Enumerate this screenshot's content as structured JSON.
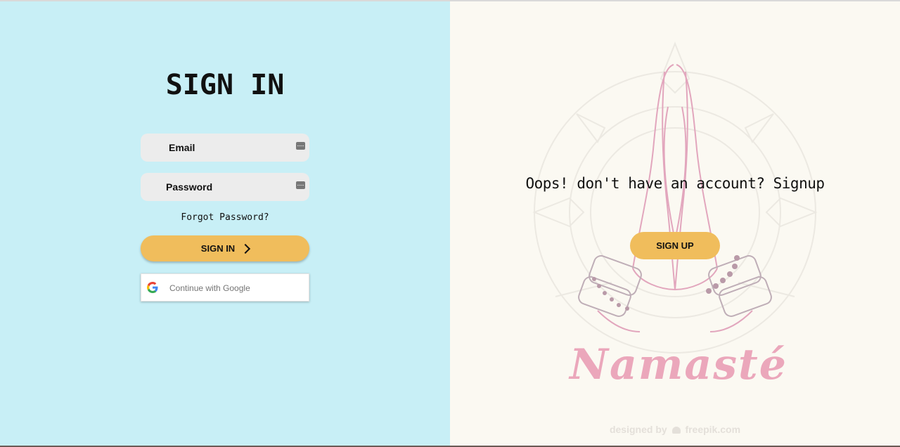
{
  "signin": {
    "title": "SIGN IN",
    "email_placeholder": "Email",
    "password_placeholder": "Password",
    "forgot_password": "Forgot Password?",
    "button_label": "SIGN IN",
    "google_label": "Continue with Google"
  },
  "signup_panel": {
    "prompt": "Oops! don't have an account? Signup",
    "button_label": "SIGN UP",
    "artwork_word": "Namasté",
    "credit_prefix": "designed by",
    "credit_brand": "freepik.com"
  },
  "colors": {
    "left_bg": "#c8eff6",
    "right_bg": "#fbf9f2",
    "accent": "#f0bd5c",
    "field_bg": "#ececec",
    "artwork_pink": "#eba7bb"
  },
  "icons": [
    "keyboard-icon",
    "chevron-right-icon",
    "google-g-icon",
    "freepik-leaf-icon"
  ]
}
